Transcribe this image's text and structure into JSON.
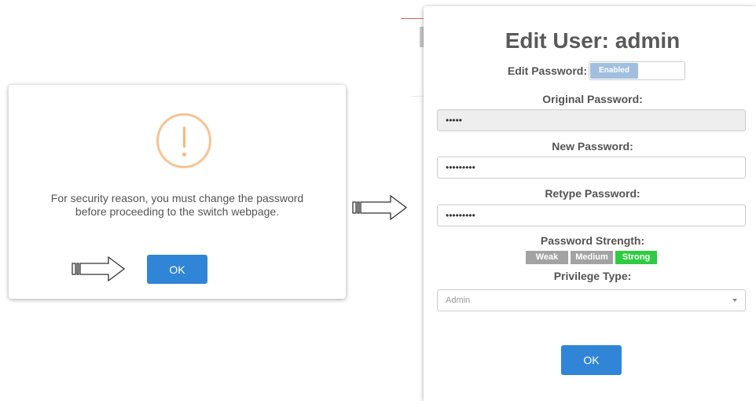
{
  "alert": {
    "icon": "warning-exclamation-icon",
    "message_line1": "For security reason, you must change the password",
    "message_line2": "before proceeding to the switch webpage.",
    "ok_label": "OK"
  },
  "edit_dialog": {
    "title": "Edit User: admin",
    "edit_password_label": "Edit Password:",
    "edit_password_toggle": "Enabled",
    "original_password_label": "Original Password:",
    "original_password_value": "•••••",
    "new_password_label": "New Password:",
    "new_password_value": "•••••••••",
    "retype_password_label": "Retype Password:",
    "retype_password_value": "•••••••••",
    "strength_label": "Password Strength:",
    "strength_levels": [
      "Weak",
      "Medium",
      "Strong"
    ],
    "strength_current": "Strong",
    "privilege_label": "Privilege Type:",
    "privilege_value": "Admin",
    "ok_label": "OK"
  },
  "colors": {
    "button_blue": "#3085d6",
    "warning_orange": "#f8c391",
    "strength_inactive": "#a3a3a3",
    "strength_active": "#2ecc40",
    "toggle_on": "#a1bfde"
  }
}
